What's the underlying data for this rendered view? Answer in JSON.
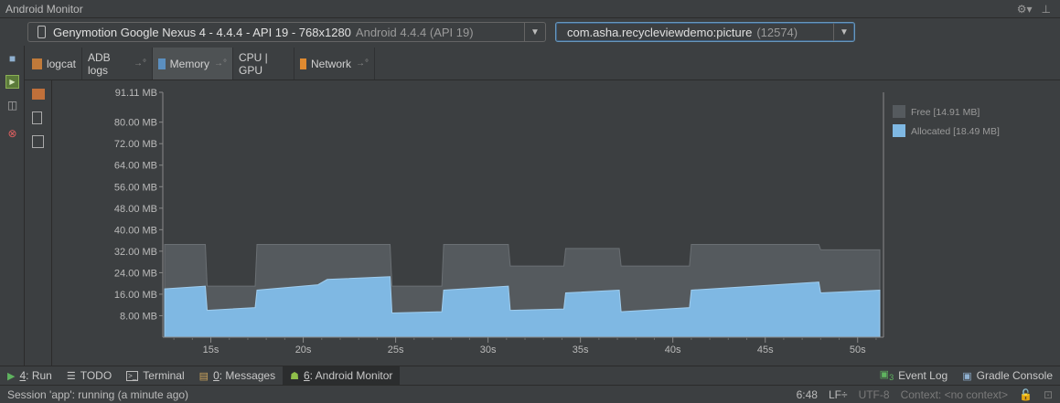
{
  "window": {
    "title": "Android Monitor"
  },
  "device_selector": {
    "device": "Genymotion Google Nexus 4 - 4.4.4 - API 19 - 768x1280",
    "os": "Android 4.4.4 (API 19)"
  },
  "process_selector": {
    "name": "com.asha.recycleviewdemo:picture",
    "pid": "(12574)"
  },
  "tabs": [
    {
      "label": "logcat"
    },
    {
      "label": "ADB logs",
      "pin": "→°"
    },
    {
      "label": "Memory",
      "pin": "→°"
    },
    {
      "label": "CPU | GPU"
    },
    {
      "label": "Network",
      "pin": "→°"
    }
  ],
  "icons": {
    "settings": "gear-icon",
    "hide": "hide-icon",
    "screenshot": "camera-icon",
    "record": "screen-record-icon",
    "layout": "layout-inspector-icon",
    "terminate": "terminate-icon",
    "gc": "garbage-collect-icon",
    "dump_heap": "dump-heap-icon",
    "alloc_tracker": "allocation-tracker-icon"
  },
  "colors": {
    "free": "#555a5e",
    "allocated": "#7fb8e3",
    "chart_bg": "#3c3f41",
    "selection": "#6897bb"
  },
  "chart_data": {
    "type": "area",
    "title": "",
    "xlabel": "",
    "ylabel": "",
    "y_tick_labels": [
      "91.11 MB",
      "80.00 MB",
      "72.00 MB",
      "64.00 MB",
      "56.00 MB",
      "48.00 MB",
      "40.00 MB",
      "32.00 MB",
      "24.00 MB",
      "16.00 MB",
      "8.00 MB"
    ],
    "y_tick_values": [
      91.11,
      80,
      72,
      64,
      56,
      48,
      40,
      32,
      24,
      16,
      8
    ],
    "x_tick_labels": [
      "15s",
      "20s",
      "25s",
      "30s",
      "35s",
      "40s",
      "45s",
      "50s"
    ],
    "x_tick_values": [
      15,
      20,
      25,
      30,
      35,
      40,
      45,
      50
    ],
    "xlim": [
      12.4,
      51.3
    ],
    "ylim": [
      0,
      91.11
    ],
    "legend_position": "right",
    "grid": false,
    "series": [
      {
        "name": "Free [14.91 MB]",
        "values_total": [
          [
            12.5,
            34.5
          ],
          [
            14.7,
            34.5
          ],
          [
            14.8,
            19
          ],
          [
            17.4,
            19
          ],
          [
            17.5,
            34.5
          ],
          [
            24.7,
            34.5
          ],
          [
            24.8,
            19
          ],
          [
            27.5,
            19
          ],
          [
            27.6,
            34.5
          ],
          [
            31.1,
            34.5
          ],
          [
            31.2,
            26.5
          ],
          [
            34.1,
            26.5
          ],
          [
            34.2,
            33
          ],
          [
            37.1,
            33
          ],
          [
            37.2,
            26.5
          ],
          [
            40.9,
            26.5
          ],
          [
            41.0,
            34.5
          ],
          [
            47.9,
            34.5
          ],
          [
            48.0,
            32.5
          ],
          [
            51.2,
            32.5
          ]
        ]
      },
      {
        "name": "Allocated [18.49 MB]",
        "values": [
          [
            12.5,
            18
          ],
          [
            14.7,
            19
          ],
          [
            14.8,
            10
          ],
          [
            17.4,
            11
          ],
          [
            17.5,
            17.5
          ],
          [
            20.8,
            19.5
          ],
          [
            21.3,
            21.5
          ],
          [
            24.7,
            22.5
          ],
          [
            24.8,
            9
          ],
          [
            27.5,
            9.5
          ],
          [
            27.6,
            17.5
          ],
          [
            31.1,
            19
          ],
          [
            31.2,
            10
          ],
          [
            34.1,
            10.5
          ],
          [
            34.2,
            16.5
          ],
          [
            37.1,
            17.5
          ],
          [
            37.2,
            9.5
          ],
          [
            40.9,
            11
          ],
          [
            41.0,
            17.5
          ],
          [
            47.9,
            20.5
          ],
          [
            48.0,
            16.5
          ],
          [
            51.2,
            17.5
          ]
        ]
      }
    ]
  },
  "bottom_tabs": {
    "run": {
      "num": "4",
      "label": ": Run"
    },
    "todo": {
      "label": "TODO"
    },
    "terminal": {
      "label": "Terminal"
    },
    "messages": {
      "num": "0",
      "label": ": Messages"
    },
    "monitor": {
      "num": "6",
      "label": ": Android Monitor"
    },
    "event_log": {
      "label": "Event Log",
      "num": "3"
    },
    "gradle": {
      "label": "Gradle Console"
    }
  },
  "status": {
    "message": "Session 'app': running (a minute ago)",
    "position": "6:48",
    "line_sep": "LF÷",
    "encoding": "UTF-8",
    "context": "Context: <no context>"
  }
}
